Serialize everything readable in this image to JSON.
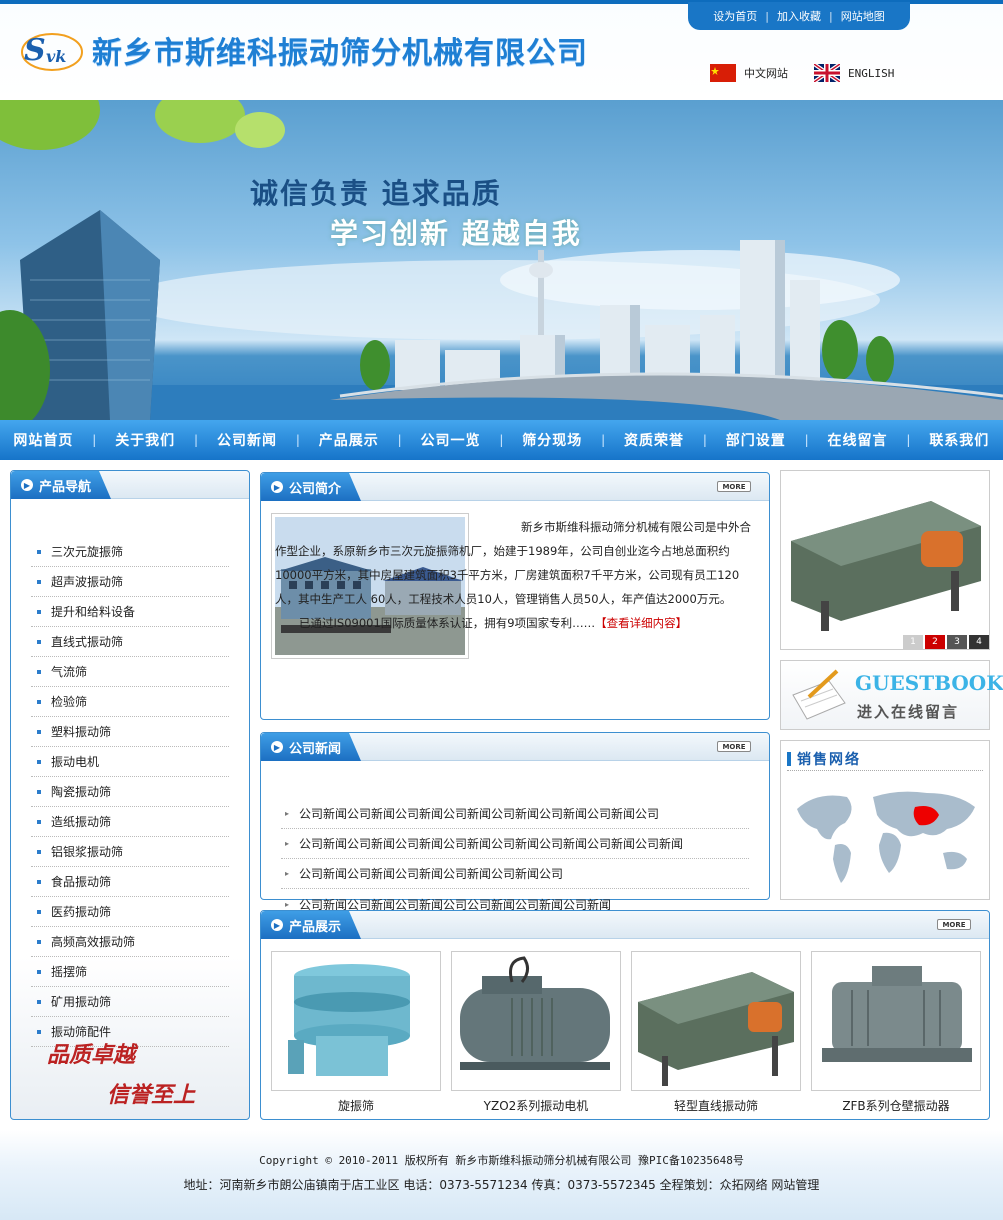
{
  "header": {
    "company_name": "新乡市斯维科振动筛分机械有限公司",
    "logo_text": "Svk",
    "top_links": [
      "设为首页",
      "加入收藏",
      "网站地图"
    ],
    "lang": {
      "cn": "中文网站",
      "en": "ENGLISH"
    }
  },
  "banner": {
    "slogan1": "诚信负责  追求品质",
    "slogan2": "学习创新  超越自我"
  },
  "nav": [
    "网站首页",
    "关于我们",
    "公司新闻",
    "产品展示",
    "公司一览",
    "筛分现场",
    "资质荣誉",
    "部门设置",
    "在线留言",
    "联系我们"
  ],
  "left": {
    "title": "产品导航",
    "items": [
      "三次元旋振筛",
      "超声波振动筛",
      "提升和给料设备",
      "直线式振动筛",
      "气流筛",
      "检验筛",
      "塑料振动筛",
      "振动电机",
      "陶瓷振动筛",
      "造纸振动筛",
      "铝银浆振动筛",
      "食品振动筛",
      "医药振动筛",
      "高频高效振动筛",
      "摇摆筛",
      "矿用振动筛",
      "振动筛配件"
    ],
    "slogan1": "品质卓越",
    "slogan2": "信誉至上"
  },
  "intro": {
    "title": "公司简介",
    "more": "MORE",
    "para1": "新乡市斯维科振动筛分机械有限公司是中外合作型企业，系原新乡市三次元旋振筛机厂，始建于1989年，公司自创业迄今占地总面积约 10000平方米，其中房屋建筑面积3千平方米，厂房建筑面积7千平方米，公司现有员工120人，其中生产工人 60人，工程技术人员10人，管理销售人员50人，年产值达2000万元。",
    "para2": "已通过IS09001国际质量体系认证，拥有9项国家专利……",
    "detail_link": "【查看详细内容】"
  },
  "news": {
    "title": "公司新闻",
    "more": "MORE",
    "items": [
      "公司新闻公司新闻公司新闻公司新闻公司新闻公司新闻公司新闻公司",
      "公司新闻公司新闻公司新闻公司新闻公司新闻公司新闻公司新闻公司新闻",
      "公司新闻公司新闻公司新闻公司新闻公司新闻公司",
      "公司新闻公司新闻公司新闻公司公司新闻公司新闻公司新闻"
    ]
  },
  "slider": {
    "pages": [
      "1",
      "2",
      "3",
      "4"
    ],
    "active": "2"
  },
  "guestbook": {
    "title": "GUESTBOOK",
    "subtitle": "进入在线留言"
  },
  "sales": {
    "title": "销售网络"
  },
  "products": {
    "title": "产品展示",
    "more": "MORE",
    "items": [
      {
        "name": "旋振筛"
      },
      {
        "name": "YZO2系列振动电机"
      },
      {
        "name": "轻型直线振动筛"
      },
      {
        "name": "ZFB系列仓壁振动器"
      }
    ]
  },
  "footer": {
    "line1": "Copyright © 2010-2011 版权所有 新乡市斯维科振动筛分机械有限公司 豫PIC备10235648号",
    "line2": "地址：河南新乡市朗公庙镇南于店工业区  电话：0373-5571234 传真：0373-5572345 全程策划：众拓网络  网站管理"
  },
  "colors": {
    "primary": "#1976c6",
    "nav": "#2a8ad9",
    "accent_red": "#cc0000"
  }
}
